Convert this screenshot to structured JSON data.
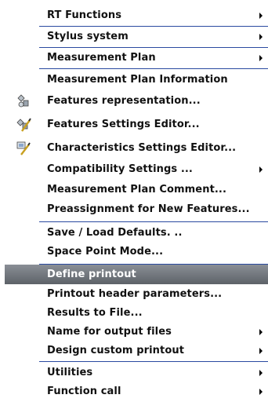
{
  "menu": {
    "items": [
      {
        "label": "RT Functions",
        "submenu": true
      },
      {
        "label": "Stylus system",
        "submenu": true
      },
      {
        "label": "Measurement Plan",
        "submenu": true
      },
      {
        "label": "Measurement Plan Information",
        "submenu": false
      },
      {
        "label": "Features representation...",
        "submenu": false,
        "icon": "features-representation-icon"
      },
      {
        "label": "Features Settings Editor...",
        "submenu": false,
        "icon": "features-settings-editor-icon"
      },
      {
        "label": "Characteristics Settings Editor...",
        "submenu": false,
        "icon": "characteristics-settings-editor-icon"
      },
      {
        "label": "Compatibility Settings ...",
        "submenu": true
      },
      {
        "label": "Measurement Plan Comment...",
        "submenu": false
      },
      {
        "label": "Preassignment for New Features...",
        "submenu": false
      },
      {
        "label": "Save / Load Defaults. ..",
        "submenu": false
      },
      {
        "label": "Space Point Mode...",
        "submenu": false
      },
      {
        "label": "Define printout",
        "submenu": false,
        "selected": true
      },
      {
        "label": "Printout header parameters...",
        "submenu": false
      },
      {
        "label": "Results to File...",
        "submenu": false
      },
      {
        "label": "Name for output files",
        "submenu": true
      },
      {
        "label": "Design custom printout",
        "submenu": true
      },
      {
        "label": "Utilities",
        "submenu": true
      },
      {
        "label": "Function call",
        "submenu": true
      }
    ]
  },
  "colors": {
    "separator": "#2a4aa0",
    "selected_bg": "#6e737a",
    "text": "#111111"
  }
}
